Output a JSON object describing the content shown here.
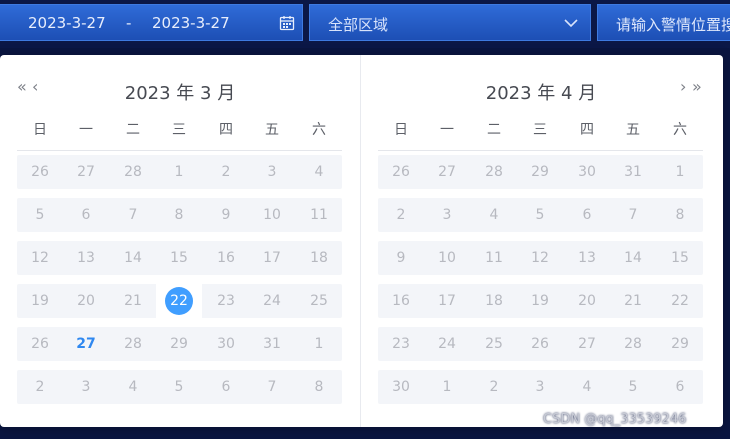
{
  "filter_bar": {
    "date_start": "2023-3-27",
    "date_separator": "-",
    "date_end": "2023-3-27",
    "calendar_icon": "calendar-icon",
    "area_select_value": "全部区域",
    "area_select_icon": "chevron-down-icon",
    "search_placeholder": "请输入警情位置搜"
  },
  "picker": {
    "prev_year_icon": "double-chevron-left-icon",
    "prev_month_icon": "chevron-left-icon",
    "next_month_icon": "chevron-right-icon",
    "next_year_icon": "double-chevron-right-icon",
    "weekdays": [
      "日",
      "一",
      "二",
      "三",
      "四",
      "五",
      "六"
    ],
    "left": {
      "title": "2023 年 3 月",
      "weeks": [
        [
          "26",
          "27",
          "28",
          "1",
          "2",
          "3",
          "4"
        ],
        [
          "5",
          "6",
          "7",
          "8",
          "9",
          "10",
          "11"
        ],
        [
          "12",
          "13",
          "14",
          "15",
          "16",
          "17",
          "18"
        ],
        [
          "19",
          "20",
          "21",
          "22",
          "23",
          "24",
          "25"
        ],
        [
          "26",
          "27",
          "28",
          "29",
          "30",
          "31",
          "1"
        ],
        [
          "2",
          "3",
          "4",
          "5",
          "6",
          "7",
          "8"
        ]
      ],
      "selected_day": "22",
      "today_day": "27"
    },
    "right": {
      "title": "2023 年 4 月",
      "weeks": [
        [
          "26",
          "27",
          "28",
          "29",
          "30",
          "31",
          "1"
        ],
        [
          "2",
          "3",
          "4",
          "5",
          "6",
          "7",
          "8"
        ],
        [
          "9",
          "10",
          "11",
          "12",
          "13",
          "14",
          "15"
        ],
        [
          "16",
          "17",
          "18",
          "19",
          "20",
          "21",
          "22"
        ],
        [
          "23",
          "24",
          "25",
          "26",
          "27",
          "28",
          "29"
        ],
        [
          "30",
          "1",
          "2",
          "3",
          "4",
          "5",
          "6"
        ]
      ]
    }
  },
  "watermark": "CSDN @qq_33539246",
  "colors": {
    "accent": "#409eff",
    "today_text": "#2f88f0",
    "bar_blue": "#1d4fb5",
    "page_bg": "#0a1540"
  }
}
